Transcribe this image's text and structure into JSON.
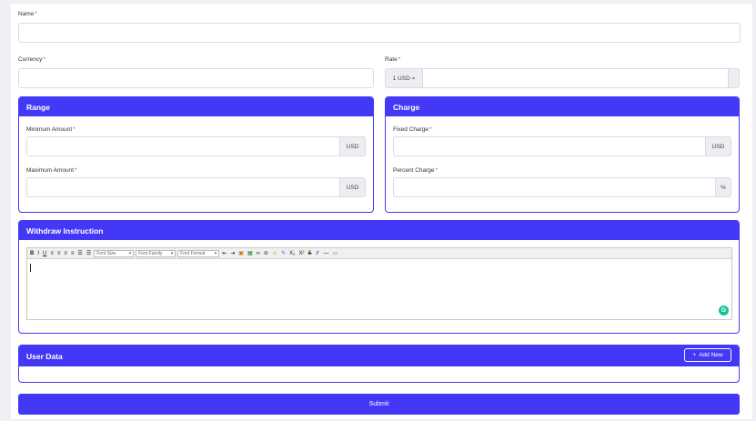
{
  "form": {
    "name_label": "Name",
    "currency_label": "Currency",
    "rate_label": "Rate",
    "rate_prefix": "1 USD =",
    "required_mark": "*"
  },
  "range": {
    "title": "Range",
    "min_label": "Minimum Amount",
    "max_label": "Maximum Amount",
    "min_addon": "USD",
    "max_addon": "USD"
  },
  "charge": {
    "title": "Charge",
    "fixed_label": "Fixed Charge",
    "percent_label": "Percent Charge",
    "fixed_addon": "USD",
    "percent_addon": "%"
  },
  "withdraw": {
    "title": "Withdraw Instruction",
    "font_size": "Font Size",
    "font_family": "Font Family",
    "font_format": "Font Format",
    "tb_bold": "B",
    "tb_italic": "I",
    "tb_underline": "U",
    "tb_sub": "X₂",
    "tb_sup": "X²",
    "tb_strike": "S",
    "grammarly": "G"
  },
  "user_data": {
    "title": "User Data",
    "add_new": "Add New",
    "add_icon": "+"
  },
  "submit_label": "Submit",
  "colors": {
    "accent": "#4338f5",
    "required": "#e0384a"
  }
}
